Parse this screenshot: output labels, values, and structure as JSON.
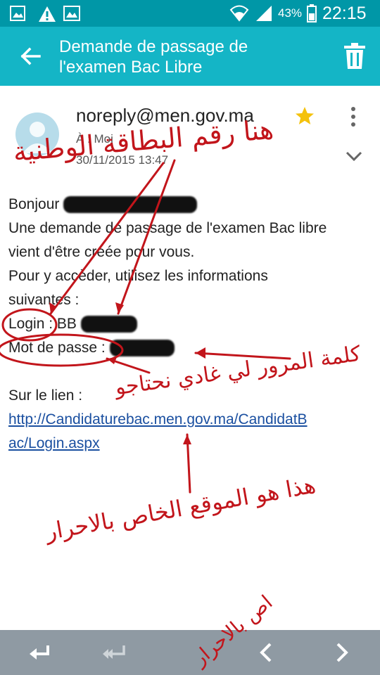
{
  "status_bar": {
    "battery_percent": "43%",
    "time": "22:15",
    "icons": [
      "gallery-icon",
      "warning-icon",
      "image-icon",
      "wifi-icon",
      "signal-icon",
      "battery-icon"
    ]
  },
  "app_bar": {
    "title": "Demande de passage de l'examen Bac Libre",
    "icons": [
      "back-arrow-icon",
      "trash-icon"
    ]
  },
  "email": {
    "sender": "noreply@men.gov.ma",
    "to_line": "À : Moi",
    "date": "30/11/2015  13:47",
    "starred": true,
    "greeting": "Bonjour",
    "body_lines": [
      "Une demande de passage de l'examen Bac libre",
      "vient d'être créée pour vous.",
      "Pour y accèder, utilisez les informations",
      "suivantes :"
    ],
    "login_label": "Login",
    "login_sep": " : ",
    "login_value_prefix": "BB",
    "password_label": "Mot de passe",
    "password_sep": " : ",
    "link_intro": "Sur le lien :",
    "link_line1": "http://Candidaturebac.men.gov.ma/CandidatB",
    "link_line2": "ac/Login.aspx"
  },
  "annotations": {
    "national_id": "هنا رقم البطاقة الوطنية",
    "password_needed": "كلمة المرور لي غادي نحتاجو",
    "site_for_free": "هذا هو الموقع الخاص بالاحرار",
    "watermark": "اص بالاحرار"
  },
  "bottom_bar": {
    "icons": [
      "reply-icon",
      "reply-all-icon",
      "previous-icon",
      "next-icon"
    ]
  },
  "colors": {
    "status_bar": "#0097a7",
    "app_bar": "#14b5c6",
    "annotation_red": "#c2151b",
    "link": "#1a4fa0",
    "bottom_bar": "#8f9aa3"
  }
}
